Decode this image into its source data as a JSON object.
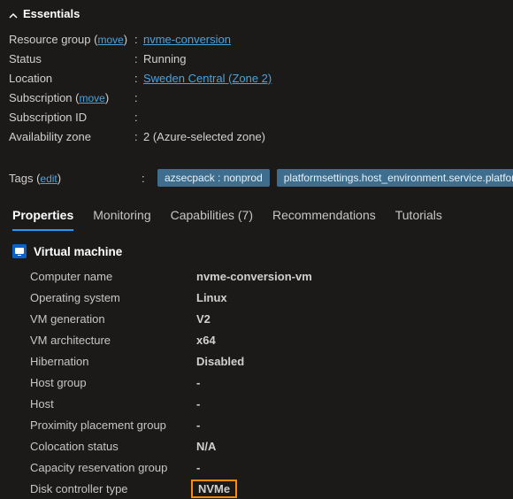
{
  "essentials": {
    "title": "Essentials",
    "resource_group_label": "Resource group",
    "move1": "move",
    "resource_group_value": "nvme-conversion",
    "status_label": "Status",
    "status_value": "Running",
    "location_label": "Location",
    "location_value": "Sweden Central (Zone 2)",
    "subscription_label": "Subscription",
    "move2": "move",
    "subscription_value": "",
    "subscription_id_label": "Subscription ID",
    "subscription_id_value": "",
    "availability_label": "Availability zone",
    "availability_value": "2 (Azure-selected zone)",
    "tags_label": "Tags",
    "tags_edit": "edit",
    "tag1": "azsecpack : nonprod",
    "tag2": "platformsettings.host_environment.service.platform_optedin_f...  : tr..."
  },
  "tabs": {
    "properties": "Properties",
    "monitoring": "Monitoring",
    "capabilities": "Capabilities (7)",
    "recommendations": "Recommendations",
    "tutorials": "Tutorials"
  },
  "vm": {
    "header": "Virtual machine",
    "rows": {
      "computer_name_label": "Computer name",
      "computer_name_value": "nvme-conversion-vm",
      "os_label": "Operating system",
      "os_value": "Linux",
      "gen_label": "VM generation",
      "gen_value": "V2",
      "arch_label": "VM architecture",
      "arch_value": "x64",
      "hib_label": "Hibernation",
      "hib_value": "Disabled",
      "hostgroup_label": "Host group",
      "hostgroup_value": "-",
      "host_label": "Host",
      "host_value": "-",
      "ppg_label": "Proximity placement group",
      "ppg_value": "-",
      "coloc_label": "Colocation status",
      "coloc_value": "N/A",
      "crg_label": "Capacity reservation group",
      "crg_value": "-",
      "disk_label": "Disk controller type",
      "disk_value": "NVMe"
    }
  }
}
